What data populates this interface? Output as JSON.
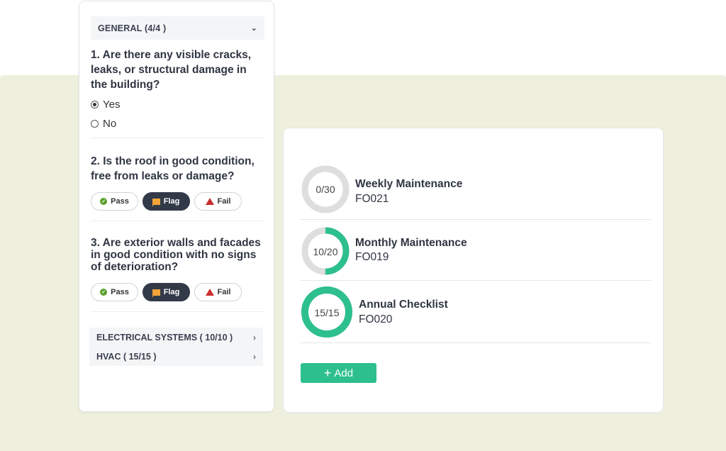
{
  "checklist": {
    "general_header": "GENERAL (4/4 )",
    "questions": [
      {
        "text": "1. Are there any visible cracks, leaks, or structural damage in the building?",
        "options": [
          "Yes",
          "No"
        ],
        "selected": "Yes"
      },
      {
        "text": "2. Is the roof in good condition, free from leaks or damage?",
        "buttons": [
          "Pass",
          "Flag",
          "Fail"
        ],
        "selected": "Flag"
      },
      {
        "text": "3. Are exterior walls and facades in good condition with no signs of deterioration?",
        "buttons": [
          "Pass",
          "Flag",
          "Fail"
        ],
        "selected": "Flag"
      }
    ],
    "collapsed_sections": [
      {
        "label": "ELECTRICAL SYSTEMS ( 10/10 )"
      },
      {
        "label": "HVAC ( 15/15 )"
      }
    ]
  },
  "forms": {
    "items": [
      {
        "name": "Weekly Maintenance",
        "code": "FO021",
        "progress_label": "0/30",
        "done": 0,
        "total": 30
      },
      {
        "name": "Monthly Maintenance",
        "code": "FO019",
        "progress_label": "10/20",
        "done": 10,
        "total": 20
      },
      {
        "name": "Annual Checklist",
        "code": "FO020",
        "progress_label": "15/15",
        "done": 15,
        "total": 15
      }
    ],
    "add_label": "Add"
  },
  "colors": {
    "accent": "#2ebf8e",
    "ring_track": "#dedede",
    "background_band": "#eef0dd",
    "flag": "#f2a43a",
    "fail": "#c8302d",
    "pass": "#5aa02c",
    "active_button": "#323a48"
  }
}
